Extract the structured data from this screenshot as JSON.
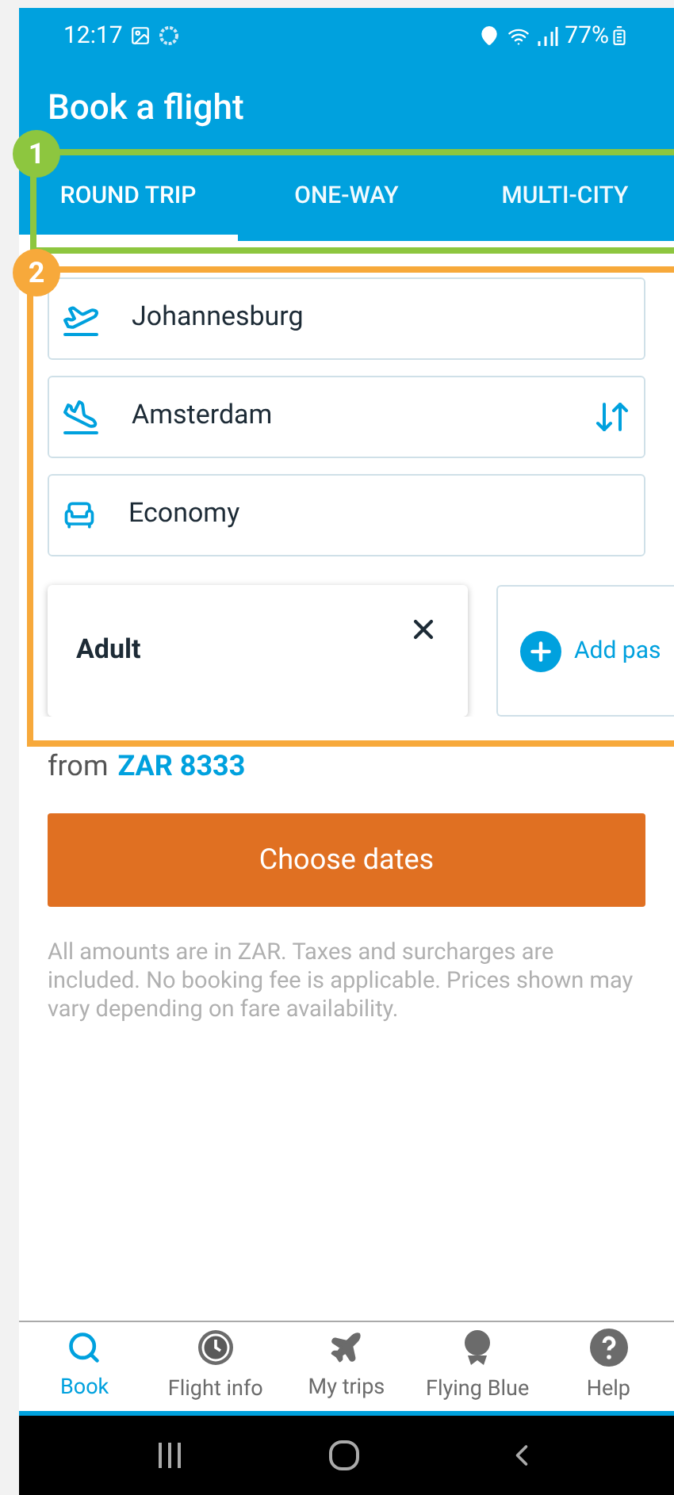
{
  "status_bar": {
    "time": "12:17",
    "battery": "77%"
  },
  "header": {
    "title": "Book a flight"
  },
  "tabs": [
    {
      "label": "ROUND TRIP",
      "selected": true
    },
    {
      "label": "ONE-WAY",
      "selected": false
    },
    {
      "label": "MULTI-CITY",
      "selected": false
    }
  ],
  "fields": [
    {
      "kind": "departure",
      "value": "Johannesburg"
    },
    {
      "kind": "arrival",
      "value": "Amsterdam"
    },
    {
      "kind": "cabin",
      "value": "Economy"
    }
  ],
  "passengers": [
    {
      "label": "Adult"
    }
  ],
  "add_passenger": {
    "label": "Add pas"
  },
  "price": {
    "prefix": "from",
    "amount": "ZAR 8333"
  },
  "primary_button": "Choose dates",
  "disclaimer": "All amounts are in ZAR. Taxes and surcharges are included. No booking fee is applicable. Prices shown may vary depending on fare availability.",
  "annotations": [
    {
      "number": "1",
      "color": "#8dc63f"
    },
    {
      "number": "2",
      "color": "#f7a93b"
    }
  ],
  "bottom_nav": [
    {
      "label": "Book",
      "selected": true
    },
    {
      "label": "Flight info",
      "selected": false
    },
    {
      "label": "My trips",
      "selected": false
    },
    {
      "label": "Flying Blue",
      "selected": false
    },
    {
      "label": "Help",
      "selected": false
    }
  ]
}
